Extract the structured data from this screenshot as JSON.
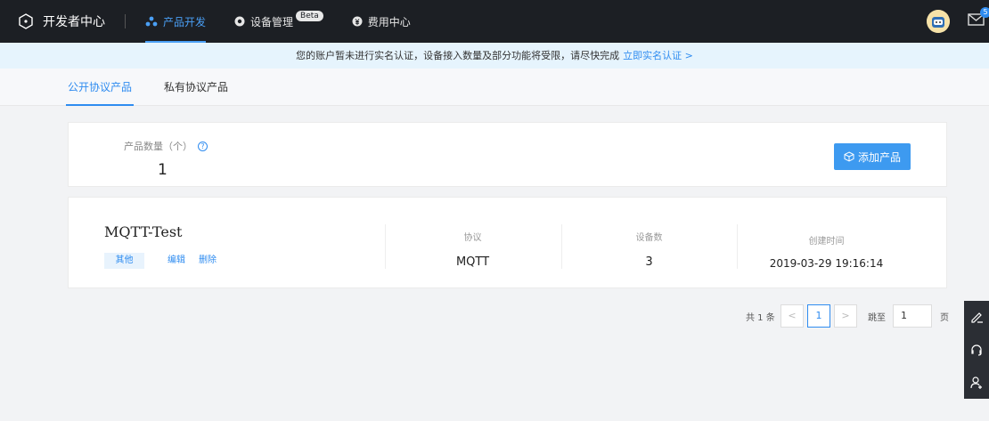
{
  "topbar": {
    "brand": "开发者中心",
    "nav": [
      {
        "label": "产品开发",
        "active": true
      },
      {
        "label": "设备管理",
        "badge": "Beta"
      },
      {
        "label": "费用中心"
      }
    ],
    "mail_badge": "5"
  },
  "notice": {
    "text": "您的账户暂未进行实名认证，设备接入数量及部分功能将受限，请尽快完成",
    "link": "立即实名认证 >"
  },
  "tabs": [
    {
      "label": "公开协议产品",
      "active": true
    },
    {
      "label": "私有协议产品",
      "active": false
    }
  ],
  "summary": {
    "count_label": "产品数量（个）",
    "count_value": "1",
    "add_button": "添加产品"
  },
  "product": {
    "name": "MQTT-Test",
    "tag": "其他",
    "edit_label": "编辑",
    "delete_label": "删除",
    "protocol_label": "协议",
    "protocol_value": "MQTT",
    "devices_label": "设备数",
    "devices_value": "3",
    "created_label": "创建时间",
    "created_value": "2019-03-29 19:16:14"
  },
  "pagination": {
    "total": "共 1 条",
    "prev": "<",
    "current": "1",
    "next": ">",
    "jump_label": "跳至",
    "jump_value": "1",
    "page_unit": "页"
  },
  "colors": {
    "accent": "#2f8cf0",
    "topbar": "#1c1f24",
    "notice_bg": "#e6f4fd"
  }
}
